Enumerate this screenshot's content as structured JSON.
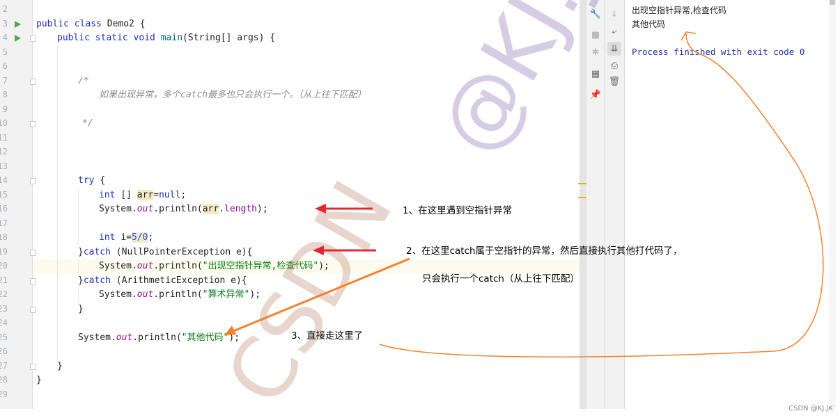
{
  "editor": {
    "line_numbers": [
      "2",
      "3",
      "4",
      "5",
      "6",
      "7",
      "8",
      "9",
      "10",
      "11",
      "12",
      "13",
      "14",
      "15",
      "16",
      "17",
      "18",
      "19",
      "20",
      "21",
      "22",
      "23",
      "24",
      "25",
      "26",
      "27",
      "28",
      "29"
    ],
    "lines": [
      {
        "n": "3",
        "indent": 0,
        "segs": [
          [
            "public class ",
            "kw"
          ],
          [
            "Demo2 {",
            ""
          ]
        ]
      },
      {
        "n": "4",
        "indent": 1,
        "segs": [
          [
            "public static void ",
            "kw"
          ],
          [
            "main",
            "fn"
          ],
          [
            "(String[] args) {",
            ""
          ]
        ]
      },
      {
        "n": "7",
        "indent": 2,
        "segs": [
          [
            "/*",
            "cm"
          ]
        ]
      },
      {
        "n": "8",
        "indent": 3,
        "segs": [
          [
            "如果出现异常，多个catch最多也只会执行一个。（从上往下匹配）",
            "cm"
          ]
        ]
      },
      {
        "n": "10",
        "indent": 2,
        "pad": 1,
        "segs": [
          [
            "*/",
            "cm"
          ]
        ]
      },
      {
        "n": "14",
        "indent": 2,
        "segs": [
          [
            "try ",
            "kw"
          ],
          [
            "{",
            ""
          ]
        ]
      },
      {
        "n": "15",
        "indent": 3,
        "segs": [
          [
            "int ",
            "kw"
          ],
          [
            "[] ",
            ""
          ],
          [
            "arr",
            "mk"
          ],
          [
            "=",
            ""
          ],
          [
            "null",
            "kw"
          ],
          [
            ";",
            ""
          ]
        ]
      },
      {
        "n": "16",
        "indent": 3,
        "segs": [
          [
            "System.",
            ""
          ],
          [
            "out",
            "it"
          ],
          [
            ".println(",
            ""
          ],
          [
            "arr",
            "mk"
          ],
          [
            ".",
            ""
          ],
          [
            "length",
            "fd"
          ],
          [
            ");",
            ""
          ]
        ]
      },
      {
        "n": "18",
        "indent": 3,
        "segs": [
          [
            "int ",
            "kw"
          ],
          [
            "i=",
            ""
          ],
          [
            "5/0",
            "nm mk"
          ],
          [
            ";",
            ""
          ]
        ]
      },
      {
        "n": "19",
        "indent": 2,
        "segs": [
          [
            "}",
            ""
          ],
          [
            "catch ",
            "kw"
          ],
          [
            "(NullPointerException e){",
            ""
          ]
        ]
      },
      {
        "n": "20",
        "indent": 3,
        "segs": [
          [
            "System.",
            ""
          ],
          [
            "out",
            "it"
          ],
          [
            ".println(",
            ""
          ],
          [
            "\"出现空指针异常,检查代码\"",
            "st"
          ],
          [
            ");",
            ""
          ]
        ]
      },
      {
        "n": "21",
        "indent": 2,
        "segs": [
          [
            "}",
            ""
          ],
          [
            "catch ",
            "kw"
          ],
          [
            "(ArithmeticException e){",
            ""
          ]
        ]
      },
      {
        "n": "22",
        "indent": 3,
        "segs": [
          [
            "System.",
            ""
          ],
          [
            "out",
            "it"
          ],
          [
            ".println(",
            ""
          ],
          [
            "\"算术异常\"",
            "st"
          ],
          [
            ");",
            ""
          ]
        ]
      },
      {
        "n": "23",
        "indent": 2,
        "segs": [
          [
            "}",
            ""
          ]
        ]
      },
      {
        "n": "25",
        "indent": 2,
        "segs": [
          [
            "System.",
            ""
          ],
          [
            "out",
            "it"
          ],
          [
            ".println(",
            ""
          ],
          [
            "\"其他代码\"",
            "st"
          ],
          [
            ");",
            ""
          ]
        ]
      },
      {
        "n": "27",
        "indent": 1,
        "segs": [
          [
            "}",
            ""
          ]
        ]
      },
      {
        "n": "28",
        "indent": 0,
        "segs": [
          [
            "}",
            ""
          ]
        ]
      }
    ],
    "run_lines": [
      "3",
      "4"
    ],
    "fold_lines": [
      "4",
      "7",
      "10",
      "14",
      "19",
      "21",
      "23",
      "27"
    ],
    "current_line": "20"
  },
  "toolbar_left": [
    "wrench-icon",
    "stop-icon",
    "settings-bug-icon",
    "layout-icon",
    "pin-icon"
  ],
  "toolbar_right": [
    "down-arrow-icon",
    "soft-wrap-icon",
    "scroll-to-end-icon",
    "print-icon",
    "trash-icon"
  ],
  "console": {
    "output": [
      "出现空指针异常,检查代码",
      "其他代码"
    ],
    "exit_message": "Process finished with exit code 0"
  },
  "annotations": {
    "note1": "1、在这里遇到空指针异常",
    "note2": "2、在这里catch属于空指针的异常，然后直接执行其他打代码了，",
    "note2b": "只会执行一个catch（从上往下匹配）",
    "note3": "3、直接走这里了",
    "red": "#e8262b",
    "orange": "#f7812b"
  },
  "watermark": "CSDN@KJ.JK",
  "footer": "CSDN @KJ.JK"
}
